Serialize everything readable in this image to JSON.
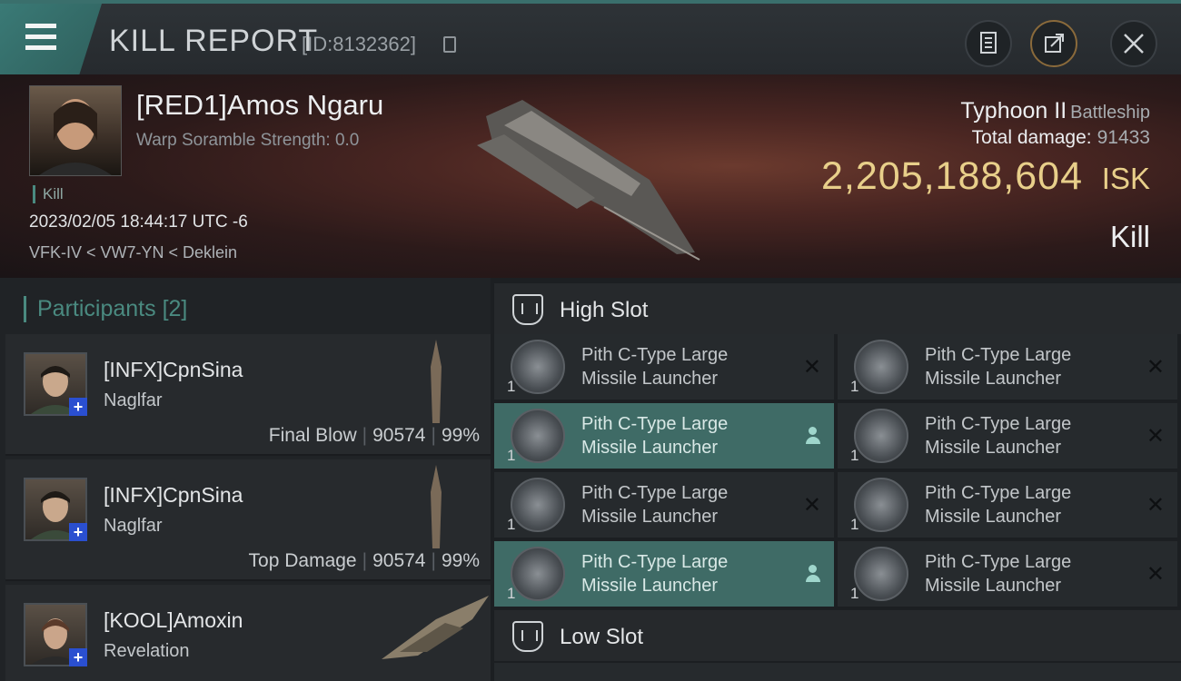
{
  "header": {
    "title": "KILL REPORT",
    "report_id": "[ID:8132362]",
    "buttons": [
      "clipboard-icon",
      "share-icon",
      "close-icon"
    ]
  },
  "victim": {
    "name": "[RED1]Amos Ngaru",
    "warp_scramble": "Warp Soramble Strength: 0.0",
    "tag": "Kill",
    "datetime": "2023/02/05 18:44:17 UTC -6",
    "location": "VFK-IV < VW7-YN < Deklein",
    "ship": "Typhoon II",
    "ship_class": "Battleship",
    "total_damage_label": "Total damage:",
    "total_damage": "91433",
    "isk_value": "2,205,188,604",
    "isk_unit": "ISK",
    "result": "Kill"
  },
  "participants": {
    "heading": "Participants",
    "count": "[2]",
    "items": [
      {
        "name": "[INFX]CpnSina",
        "ship": "Naglfar",
        "role": "Final Blow",
        "damage": "90574",
        "percent": "99%"
      },
      {
        "name": "[INFX]CpnSina",
        "ship": "Naglfar",
        "role": "Top Damage",
        "damage": "90574",
        "percent": "99%"
      },
      {
        "name": "[KOOL]Amoxin",
        "ship": "Revelation",
        "role": "",
        "damage": "",
        "percent": ""
      }
    ]
  },
  "slots": {
    "high_label": "High Slot",
    "low_label": "Low Slot",
    "modules": [
      {
        "line1": "Pith C-Type Large",
        "line2": "Missile Launcher",
        "qty": "1",
        "status": "destroyed",
        "highlighted": false
      },
      {
        "line1": "Pith C-Type Large",
        "line2": "Missile Launcher",
        "qty": "1",
        "status": "destroyed",
        "highlighted": false
      },
      {
        "line1": "Pith C-Type Large",
        "line2": "Missile Launcher",
        "qty": "1",
        "status": "dropped",
        "highlighted": true
      },
      {
        "line1": "Pith C-Type Large",
        "line2": "Missile Launcher",
        "qty": "1",
        "status": "destroyed",
        "highlighted": false
      },
      {
        "line1": "Pith C-Type Large",
        "line2": "Missile Launcher",
        "qty": "1",
        "status": "destroyed",
        "highlighted": false
      },
      {
        "line1": "Pith C-Type Large",
        "line2": "Missile Launcher",
        "qty": "1",
        "status": "destroyed",
        "highlighted": false
      },
      {
        "line1": "Pith C-Type Large",
        "line2": "Missile Launcher",
        "qty": "1",
        "status": "dropped",
        "highlighted": true
      },
      {
        "line1": "Pith C-Type Large",
        "line2": "Missile Launcher",
        "qty": "1",
        "status": "destroyed",
        "highlighted": false
      }
    ]
  }
}
